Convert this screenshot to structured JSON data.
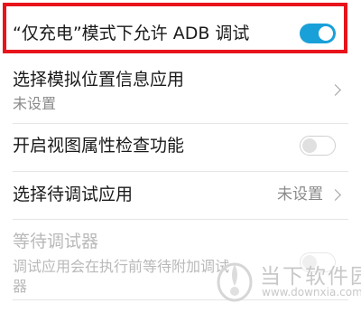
{
  "settings": {
    "usb_adb": {
      "label": "“仅充电”模式下允许 ADB 调试",
      "enabled": true
    },
    "mock_location": {
      "label": "选择模拟位置信息应用",
      "value": "未设置"
    },
    "view_attr": {
      "label": "开启视图属性检查功能",
      "enabled": false
    },
    "debug_app": {
      "label": "选择待调试应用",
      "value": "未设置"
    },
    "wait_debugger": {
      "label": "等待调试器",
      "desc_line1": "调试应用会在执行前等待附加调试",
      "desc_line2": "器",
      "enabled": false
    }
  },
  "watermark": {
    "text": "当下软件园",
    "url": "www.downxia.com"
  },
  "colors": {
    "accent": "#1aa0d8",
    "highlight": "#e8141b"
  },
  "icons": [
    "chevron-right-icon",
    "toggle-switch",
    "downxia-logo-icon"
  ]
}
